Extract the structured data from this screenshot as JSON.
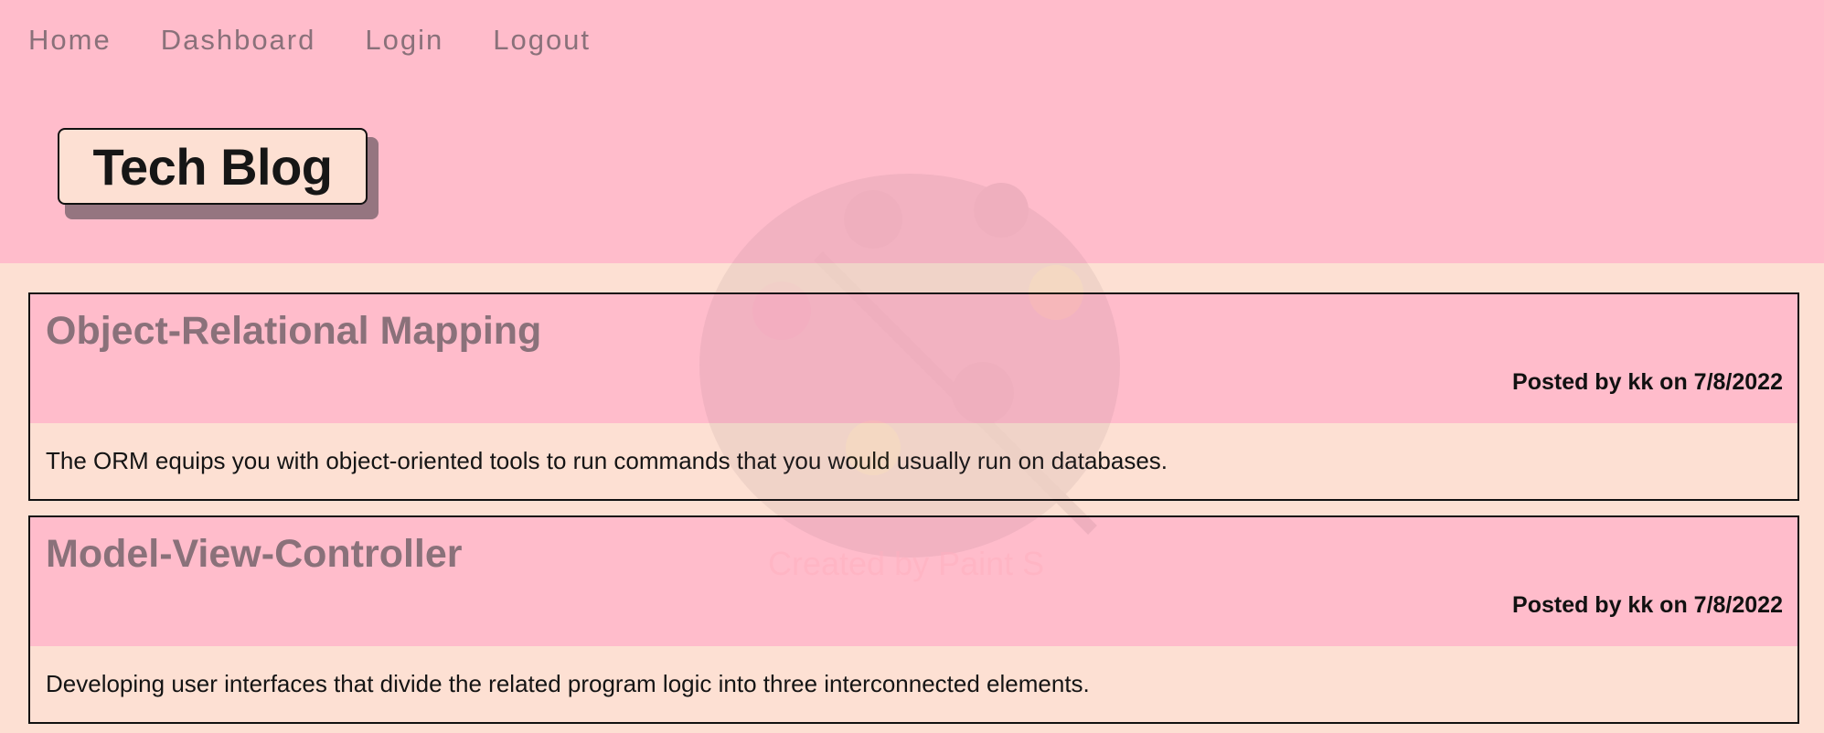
{
  "nav": {
    "items": [
      {
        "label": "Home"
      },
      {
        "label": "Dashboard"
      },
      {
        "label": "Login"
      },
      {
        "label": "Logout"
      }
    ]
  },
  "header": {
    "title": "Tech Blog"
  },
  "posts": [
    {
      "title": "Object-Relational Mapping",
      "meta": "Posted by kk on 7/8/2022",
      "body": "The ORM equips you with object-oriented tools to run commands that you would usually run on databases."
    },
    {
      "title": "Model-View-Controller",
      "meta": "Posted by kk on 7/8/2022",
      "body": "Developing user interfaces that divide the related program logic into three interconnected elements."
    }
  ],
  "watermark": {
    "text": "Created by Paint S"
  },
  "colors": {
    "header_bg": "#ffbccb",
    "page_bg": "#fde0d3",
    "muted_text": "#8a717a",
    "logo_shadow": "#957580"
  }
}
